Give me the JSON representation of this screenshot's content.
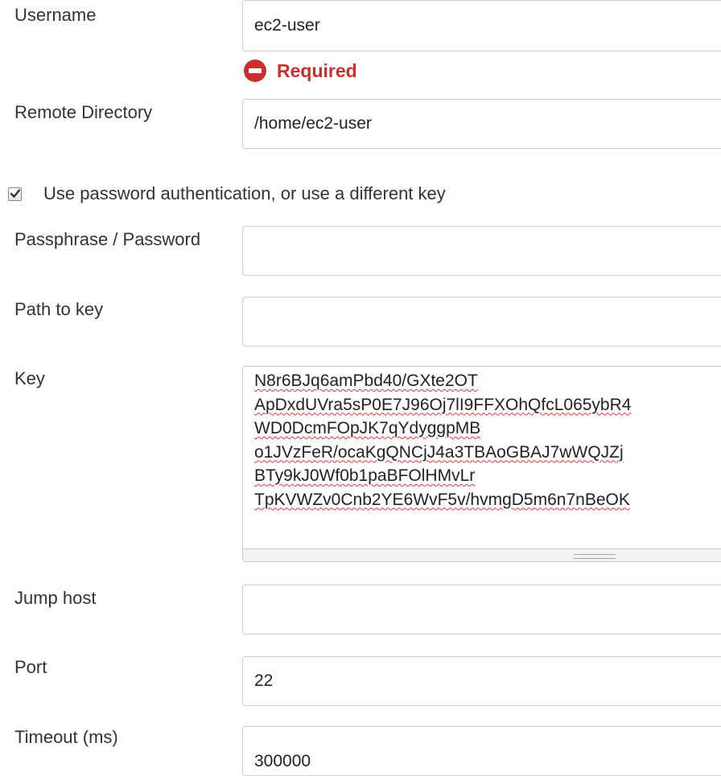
{
  "username": {
    "label": "Username",
    "value": "ec2-user",
    "validation": "Required"
  },
  "remote_directory": {
    "label": "Remote Directory",
    "value": "/home/ec2-user"
  },
  "use_password_auth": {
    "label": "Use password authentication, or use a different key",
    "checked": true
  },
  "passphrase": {
    "label": "Passphrase / Password",
    "value": ""
  },
  "path_to_key": {
    "label": "Path to key",
    "value": ""
  },
  "key": {
    "label": "Key",
    "lines": [
      "N8r6BJq6amPbd40/GXte2OT",
      "ApDxdUVra5sP0E7J96Oj7lI9FFXOhQfcL065ybR4",
      "WD0DcmFOpJK7qYdyggpMB",
      "o1JVzFeR/ocaKgQNCjJ4a3TBAoGBAJ7wWQJZj",
      "BTy9kJ0Wf0b1paBFOlHMvLr",
      "TpKVWZv0Cnb2YE6WvF5v/hvmgD5m6n7nBeOK"
    ]
  },
  "jump_host": {
    "label": "Jump host",
    "value": ""
  },
  "port": {
    "label": "Port",
    "value": "22"
  },
  "timeout": {
    "label": "Timeout (ms)",
    "value": "300000"
  },
  "colors": {
    "error": "#c9302c",
    "border": "#cccccc",
    "text": "#333333"
  }
}
